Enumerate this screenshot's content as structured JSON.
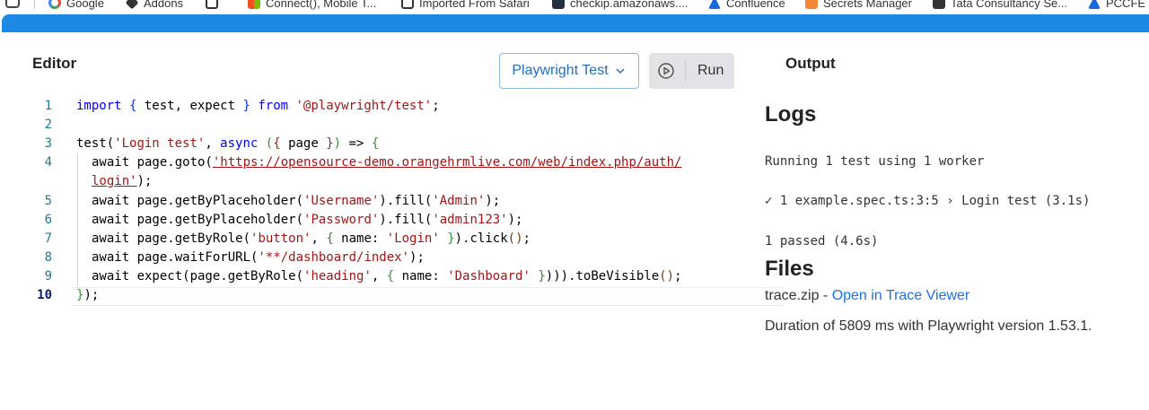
{
  "bookmarks": [
    {
      "label": "Google",
      "icon": "google-icon",
      "color": "#4285f4"
    },
    {
      "label": "Addons",
      "icon": "addons-icon",
      "color": "#333333"
    },
    {
      "label": "",
      "icon": "folder-icon",
      "color": "#333333"
    },
    {
      "label": "Connect(), Mobile T...",
      "icon": "windows-icon",
      "color": "#f25022"
    },
    {
      "label": "Imported From Safari",
      "icon": "folder-icon",
      "color": "#333333"
    },
    {
      "label": "checkip.amazonaws....",
      "icon": "aws-icon",
      "color": "#232f3e"
    },
    {
      "label": "Confluence",
      "icon": "confluence-icon",
      "color": "#1868db"
    },
    {
      "label": "Secrets Manager",
      "icon": "secrets-icon",
      "color": "#f58534"
    },
    {
      "label": "Tata Consultancy Se...",
      "icon": "tcs-icon",
      "color": "#333333"
    },
    {
      "label": "PCCFE T",
      "icon": "confluence-icon",
      "color": "#1868db"
    }
  ],
  "editor": {
    "title": "Editor",
    "framework": "Playwright Test",
    "run_label": "Run"
  },
  "code": {
    "line_numbers": [
      "1",
      "2",
      "3",
      "4",
      "",
      "5",
      "6",
      "7",
      "8",
      "9",
      "10"
    ],
    "lines": {
      "l1_import": "import",
      "l1_names": " test, expect ",
      "l1_from": "from",
      "l1_module": "'@playwright/test'",
      "l3_test": "test(",
      "l3_name": "'Login test'",
      "l3_async": "async",
      "l3_page": " page ",
      "l3_arrow": " => ",
      "l4_pre": "await page.goto(",
      "l4_url": "'https://opensource-demo.orangehrmlive.com/web/index.php/auth/",
      "l4b_url": "login'",
      "l4b_post": ");",
      "l5_pre": "await page.getByPlaceholder(",
      "l5_arg": "'Username'",
      "l5_mid": ").fill(",
      "l5_val": "'Admin'",
      "l6_pre": "await page.getByPlaceholder(",
      "l6_arg": "'Password'",
      "l6_mid": ").fill(",
      "l6_val": "'admin123'",
      "l7_pre": "await page.getByRole(",
      "l7_arg": "'button'",
      "l7_name": " name: ",
      "l7_val": "'Login'",
      "l7_post": ").click",
      "l8_pre": "await page.waitForURL(",
      "l8_arg": "'**/dashboard/index'",
      "l9_pre": "await expect(page.getByRole(",
      "l9_arg": "'heading'",
      "l9_name": " name: ",
      "l9_val": "'Dashboard'",
      "l9_post": ").toBeVisible"
    }
  },
  "output": {
    "title": "Output",
    "logs_title": "Logs",
    "logs": [
      "Running 1 test using 1 worker",
      "✓ 1 example.spec.ts:3:5 › Login test (3.1s)",
      "1 passed (4.6s)"
    ],
    "files_title": "Files",
    "trace_file": "trace.zip - ",
    "trace_link": "Open in Trace Viewer",
    "duration": "Duration of 5809 ms with Playwright version 1.53.1."
  },
  "colors": {
    "header_blue": "#1e88e5",
    "link_blue": "#1a73e8",
    "keyword": "#0000ff",
    "string": "#a31515"
  }
}
